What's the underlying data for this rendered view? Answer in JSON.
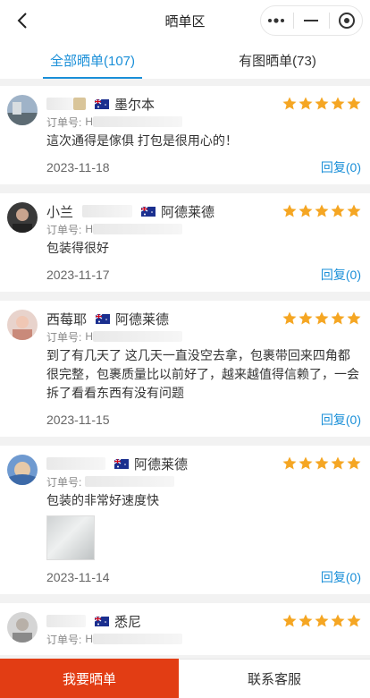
{
  "header": {
    "title": "晒单区"
  },
  "tabs": [
    {
      "label": "全部晒单(107)",
      "active": true
    },
    {
      "label": "有图晒单(73)",
      "active": false
    }
  ],
  "reviews": [
    {
      "user": "",
      "location": "墨尔本",
      "order_label": "订单号:",
      "order_no": "H",
      "rating": 5,
      "text": "這次通得是傢俱 打包是很用心的！",
      "date": "2023-11-18",
      "reply": "回复(0)"
    },
    {
      "user": "小兰",
      "location": "阿德莱德",
      "order_label": "订单号:",
      "order_no": "H",
      "rating": 5,
      "text": "包装得很好",
      "date": "2023-11-17",
      "reply": "回复(0)"
    },
    {
      "user": "西莓耶",
      "location": "阿德莱德",
      "order_label": "订单号:",
      "order_no": "H",
      "rating": 5,
      "text": "到了有几天了 这几天一直没空去拿，包裹带回来四角都很完整，包裹质量比以前好了，越来越值得信赖了，一会拆了看看东西有没有问题",
      "date": "2023-11-15",
      "reply": "回复(0)"
    },
    {
      "user": "",
      "location": "阿德莱德",
      "order_label": "订单号:",
      "order_no": "",
      "rating": 5,
      "text": "包装的非常好速度快",
      "date": "2023-11-14",
      "reply": "回复(0)",
      "has_photo": true
    },
    {
      "user": "",
      "location": "悉尼",
      "order_label": "订单号:",
      "order_no": "H",
      "rating": 5,
      "text": "",
      "date": "",
      "reply": ""
    }
  ],
  "bottom": {
    "share_label": "我要晒单",
    "service_label": "联系客服"
  },
  "colors": {
    "accent": "#1a8fd8",
    "star": "#f5a623",
    "primary_button": "#e23d14"
  }
}
